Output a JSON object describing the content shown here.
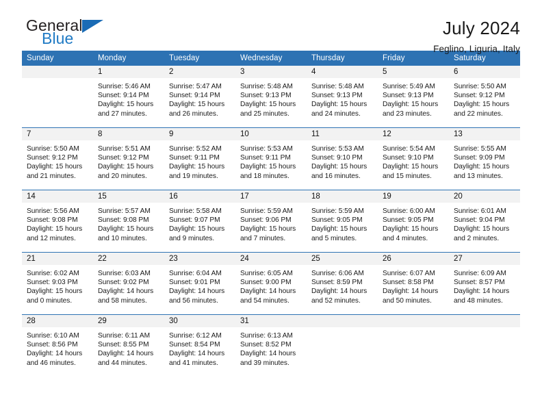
{
  "logo": {
    "part1": "General",
    "part2": "Blue",
    "triangle_color": "#1a6bb5"
  },
  "header": {
    "title": "July 2024",
    "location": "Feglino, Liguria, Italy"
  },
  "theme": {
    "header_blue": "#2d72b3",
    "daynum_band": "#f2f2f2",
    "text": "#1a1a1a"
  },
  "calendar": {
    "weekdays": [
      "Sunday",
      "Monday",
      "Tuesday",
      "Wednesday",
      "Thursday",
      "Friday",
      "Saturday"
    ],
    "weeks": [
      [
        {
          "day": "",
          "sunrise": "",
          "sunset": "",
          "daylight": "",
          "empty": true
        },
        {
          "day": "1",
          "sunrise": "Sunrise: 5:46 AM",
          "sunset": "Sunset: 9:14 PM",
          "daylight": "Daylight: 15 hours and 27 minutes."
        },
        {
          "day": "2",
          "sunrise": "Sunrise: 5:47 AM",
          "sunset": "Sunset: 9:14 PM",
          "daylight": "Daylight: 15 hours and 26 minutes."
        },
        {
          "day": "3",
          "sunrise": "Sunrise: 5:48 AM",
          "sunset": "Sunset: 9:13 PM",
          "daylight": "Daylight: 15 hours and 25 minutes."
        },
        {
          "day": "4",
          "sunrise": "Sunrise: 5:48 AM",
          "sunset": "Sunset: 9:13 PM",
          "daylight": "Daylight: 15 hours and 24 minutes."
        },
        {
          "day": "5",
          "sunrise": "Sunrise: 5:49 AM",
          "sunset": "Sunset: 9:13 PM",
          "daylight": "Daylight: 15 hours and 23 minutes."
        },
        {
          "day": "6",
          "sunrise": "Sunrise: 5:50 AM",
          "sunset": "Sunset: 9:12 PM",
          "daylight": "Daylight: 15 hours and 22 minutes."
        }
      ],
      [
        {
          "day": "7",
          "sunrise": "Sunrise: 5:50 AM",
          "sunset": "Sunset: 9:12 PM",
          "daylight": "Daylight: 15 hours and 21 minutes."
        },
        {
          "day": "8",
          "sunrise": "Sunrise: 5:51 AM",
          "sunset": "Sunset: 9:12 PM",
          "daylight": "Daylight: 15 hours and 20 minutes."
        },
        {
          "day": "9",
          "sunrise": "Sunrise: 5:52 AM",
          "sunset": "Sunset: 9:11 PM",
          "daylight": "Daylight: 15 hours and 19 minutes."
        },
        {
          "day": "10",
          "sunrise": "Sunrise: 5:53 AM",
          "sunset": "Sunset: 9:11 PM",
          "daylight": "Daylight: 15 hours and 18 minutes."
        },
        {
          "day": "11",
          "sunrise": "Sunrise: 5:53 AM",
          "sunset": "Sunset: 9:10 PM",
          "daylight": "Daylight: 15 hours and 16 minutes."
        },
        {
          "day": "12",
          "sunrise": "Sunrise: 5:54 AM",
          "sunset": "Sunset: 9:10 PM",
          "daylight": "Daylight: 15 hours and 15 minutes."
        },
        {
          "day": "13",
          "sunrise": "Sunrise: 5:55 AM",
          "sunset": "Sunset: 9:09 PM",
          "daylight": "Daylight: 15 hours and 13 minutes."
        }
      ],
      [
        {
          "day": "14",
          "sunrise": "Sunrise: 5:56 AM",
          "sunset": "Sunset: 9:08 PM",
          "daylight": "Daylight: 15 hours and 12 minutes."
        },
        {
          "day": "15",
          "sunrise": "Sunrise: 5:57 AM",
          "sunset": "Sunset: 9:08 PM",
          "daylight": "Daylight: 15 hours and 10 minutes."
        },
        {
          "day": "16",
          "sunrise": "Sunrise: 5:58 AM",
          "sunset": "Sunset: 9:07 PM",
          "daylight": "Daylight: 15 hours and 9 minutes."
        },
        {
          "day": "17",
          "sunrise": "Sunrise: 5:59 AM",
          "sunset": "Sunset: 9:06 PM",
          "daylight": "Daylight: 15 hours and 7 minutes."
        },
        {
          "day": "18",
          "sunrise": "Sunrise: 5:59 AM",
          "sunset": "Sunset: 9:05 PM",
          "daylight": "Daylight: 15 hours and 5 minutes."
        },
        {
          "day": "19",
          "sunrise": "Sunrise: 6:00 AM",
          "sunset": "Sunset: 9:05 PM",
          "daylight": "Daylight: 15 hours and 4 minutes."
        },
        {
          "day": "20",
          "sunrise": "Sunrise: 6:01 AM",
          "sunset": "Sunset: 9:04 PM",
          "daylight": "Daylight: 15 hours and 2 minutes."
        }
      ],
      [
        {
          "day": "21",
          "sunrise": "Sunrise: 6:02 AM",
          "sunset": "Sunset: 9:03 PM",
          "daylight": "Daylight: 15 hours and 0 minutes."
        },
        {
          "day": "22",
          "sunrise": "Sunrise: 6:03 AM",
          "sunset": "Sunset: 9:02 PM",
          "daylight": "Daylight: 14 hours and 58 minutes."
        },
        {
          "day": "23",
          "sunrise": "Sunrise: 6:04 AM",
          "sunset": "Sunset: 9:01 PM",
          "daylight": "Daylight: 14 hours and 56 minutes."
        },
        {
          "day": "24",
          "sunrise": "Sunrise: 6:05 AM",
          "sunset": "Sunset: 9:00 PM",
          "daylight": "Daylight: 14 hours and 54 minutes."
        },
        {
          "day": "25",
          "sunrise": "Sunrise: 6:06 AM",
          "sunset": "Sunset: 8:59 PM",
          "daylight": "Daylight: 14 hours and 52 minutes."
        },
        {
          "day": "26",
          "sunrise": "Sunrise: 6:07 AM",
          "sunset": "Sunset: 8:58 PM",
          "daylight": "Daylight: 14 hours and 50 minutes."
        },
        {
          "day": "27",
          "sunrise": "Sunrise: 6:09 AM",
          "sunset": "Sunset: 8:57 PM",
          "daylight": "Daylight: 14 hours and 48 minutes."
        }
      ],
      [
        {
          "day": "28",
          "sunrise": "Sunrise: 6:10 AM",
          "sunset": "Sunset: 8:56 PM",
          "daylight": "Daylight: 14 hours and 46 minutes."
        },
        {
          "day": "29",
          "sunrise": "Sunrise: 6:11 AM",
          "sunset": "Sunset: 8:55 PM",
          "daylight": "Daylight: 14 hours and 44 minutes."
        },
        {
          "day": "30",
          "sunrise": "Sunrise: 6:12 AM",
          "sunset": "Sunset: 8:54 PM",
          "daylight": "Daylight: 14 hours and 41 minutes."
        },
        {
          "day": "31",
          "sunrise": "Sunrise: 6:13 AM",
          "sunset": "Sunset: 8:52 PM",
          "daylight": "Daylight: 14 hours and 39 minutes."
        },
        {
          "day": "",
          "sunrise": "",
          "sunset": "",
          "daylight": "",
          "empty": true
        },
        {
          "day": "",
          "sunrise": "",
          "sunset": "",
          "daylight": "",
          "empty": true
        },
        {
          "day": "",
          "sunrise": "",
          "sunset": "",
          "daylight": "",
          "empty": true
        }
      ]
    ]
  }
}
